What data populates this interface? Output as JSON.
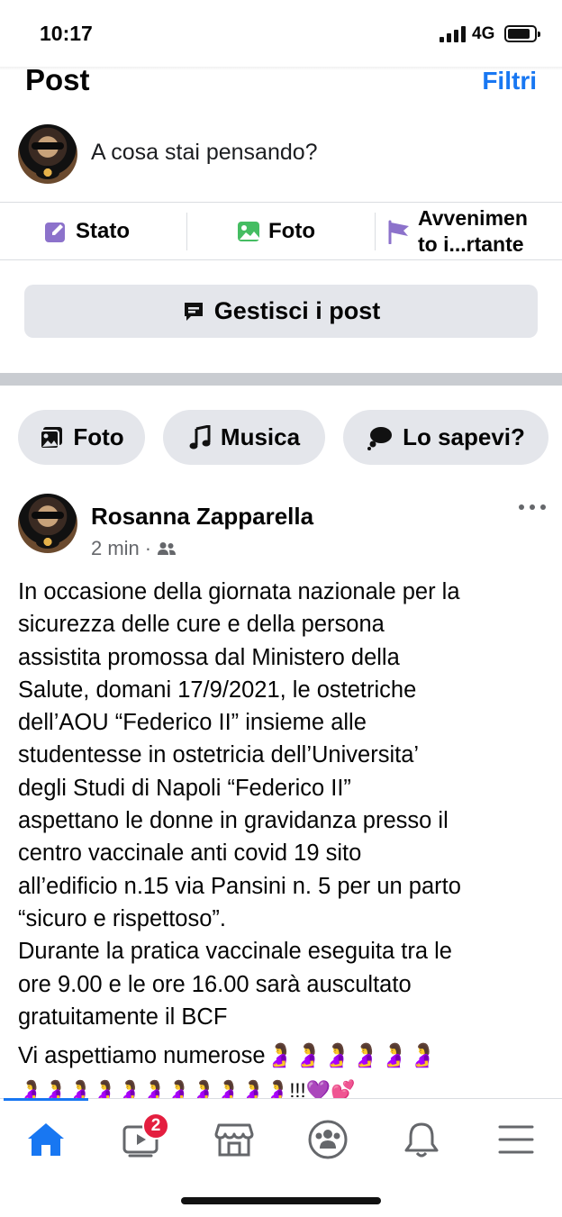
{
  "status": {
    "time": "10:17",
    "network": "4G"
  },
  "header": {
    "title": "Post",
    "filters_label": "Filtri"
  },
  "composer": {
    "prompt": "A cosa stai pensando?"
  },
  "actions": [
    {
      "label": "Stato",
      "icon": "edit-icon",
      "color": "#8c72cb"
    },
    {
      "label": "Foto",
      "icon": "photo-icon",
      "color": "#45bd62"
    },
    {
      "label_line1": "Avvenimen",
      "label_line2": "to i...rtante",
      "icon": "flag-icon",
      "color": "#8c72cb"
    }
  ],
  "manage_posts": {
    "label": "Gestisci i post"
  },
  "chips": [
    {
      "label": "Foto",
      "icon": "photo-icon"
    },
    {
      "label": "Musica",
      "icon": "music-note-icon"
    },
    {
      "label": "Lo sapevi?",
      "icon": "thought-bubble-icon"
    }
  ],
  "post": {
    "author": "Rosanna Zapparella",
    "time": "2 min",
    "audience_icon": "friends-icon",
    "body": "In occasione della giornata nazionale per la\nsicurezza delle cure e della persona\nassistita promossa dal Ministero della\nSalute, domani 17/9/2021, le ostetriche\ndell’AOU “Federico II” insieme alle\nstudentesse in ostetricia dell’Universita’\ndegli Studi di Napoli “Federico II”\naspettano le donne in gravidanza presso il\ncentro vaccinale anti covid 19 sito\nall’edificio n.15 via Pansini n. 5 per un parto\n“sicuro e rispettoso”.\nDurante la pratica vaccinale eseguita tra le\nore 9.00 e le ore 16.00 sarà auscultato\ngratuitamente il BCF",
    "tail": "Vi aspettiamo numerose🤰🤰🤰🤰🤰🤰",
    "emoji_row": "🤰🤰🤰🤰🤰🤰🤰🤰🤰🤰🤰!!!💜💕"
  },
  "tabbar": {
    "items": [
      "home-icon",
      "video-icon",
      "marketplace-icon",
      "groups-icon",
      "notifications-icon",
      "menu-icon"
    ],
    "video_badge": "2",
    "accent": "#1877f2"
  }
}
